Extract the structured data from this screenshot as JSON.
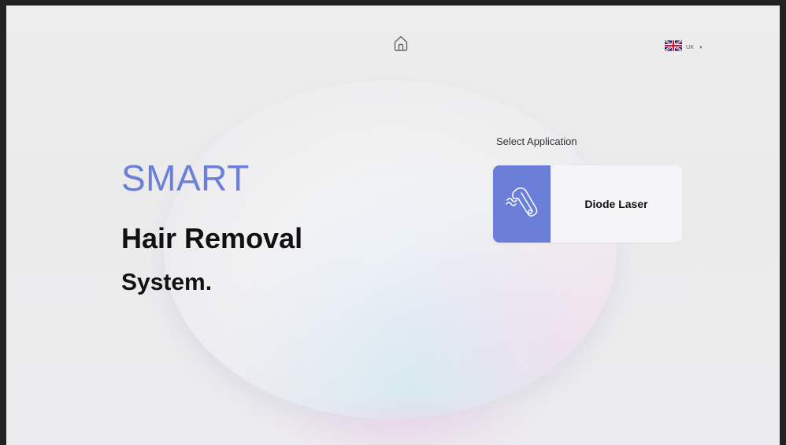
{
  "header": {
    "home_icon": "home-icon",
    "language": {
      "flag_icon": "uk-flag-icon",
      "code": "UK",
      "caret": "▾"
    }
  },
  "hero": {
    "highlight": "SMART",
    "line1": "Hair Removal",
    "line2": "System."
  },
  "applications": {
    "section_label": "Select Application",
    "items": [
      {
        "label": "Diode Laser",
        "icon": "laser-handpiece-icon"
      }
    ]
  },
  "colors": {
    "accent": "#6b7fd8",
    "text_primary": "#111111",
    "background": "#ededed"
  }
}
